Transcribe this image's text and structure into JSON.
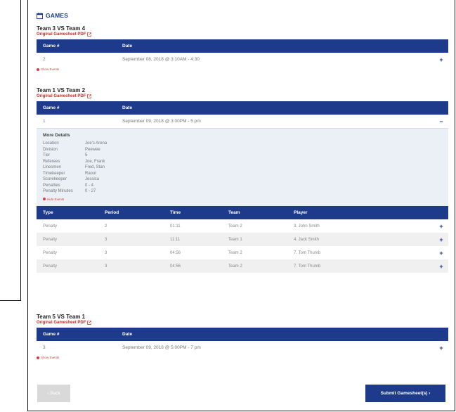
{
  "games_header": {
    "title": "GAMES",
    "icon": "calendar-icon"
  },
  "matches": [
    {
      "title": "Team 3 VS Team 4",
      "pdf_label": "Original Gamesheet PDF",
      "headers": {
        "game": "Game #",
        "date": "Date"
      },
      "row": {
        "game": "2",
        "date": "September 08, 2018 @ 3:10AM - 4:30",
        "action": "+"
      },
      "events_toggle": "Show Events"
    },
    {
      "title": "Team 1 VS Team 2",
      "pdf_label": "Original Gamesheet PDF",
      "headers": {
        "game": "Game #",
        "date": "Date"
      },
      "row": {
        "game": "1",
        "date": "September 09, 2018 @ 3:00PM - 5 pm",
        "action": "−"
      },
      "details": {
        "title": "More Details",
        "items": [
          {
            "key": "Location",
            "value": "Joe's Arena"
          },
          {
            "key": "Division",
            "value": "Peewee"
          },
          {
            "key": "Tier",
            "value": "5"
          },
          {
            "key": "Referees",
            "value": "Joe, Frank"
          },
          {
            "key": "Linesmen",
            "value": "Fred, Stan"
          },
          {
            "key": "Timekeeper",
            "value": "Raoul"
          },
          {
            "key": "Scorekeeper",
            "value": "Jessica"
          },
          {
            "key": "Penalties",
            "value": "0 - 4"
          },
          {
            "key": "Penalty Minutes",
            "value": "0 - 27"
          }
        ]
      },
      "events_toggle": "Hide Events",
      "events": {
        "headers": {
          "type": "Type",
          "period": "Period",
          "time": "Time",
          "team": "Team",
          "player": "Player"
        },
        "rows": [
          {
            "type": "Penalty",
            "period": "2",
            "time": "01:11",
            "team": "Team 2",
            "player": "3. John Smith",
            "action": "+"
          },
          {
            "type": "Penalty",
            "period": "3",
            "time": "11:11",
            "team": "Team 1",
            "player": "4. Jack Smith",
            "action": "+"
          },
          {
            "type": "Penalty",
            "period": "3",
            "time": "04:56",
            "team": "Team 2",
            "player": "7. Tom Thumb",
            "action": "+"
          },
          {
            "type": "Penalty",
            "period": "3",
            "time": "04:56",
            "team": "Team 2",
            "player": "7. Tom Thumb",
            "action": "+"
          }
        ]
      }
    },
    {
      "title": "Team 5 VS Team 1",
      "pdf_label": "Original Gamesheet PDF",
      "headers": {
        "game": "Game #",
        "date": "Date"
      },
      "row": {
        "game": "3",
        "date": "September 09, 2018 @ 5:00PM - 7 pm",
        "action": "+"
      },
      "events_toggle": "Show Events"
    }
  ],
  "buttons": {
    "back": "‹ Back",
    "submit": "Submit Gamesheet(s) ›"
  },
  "colors": {
    "primary": "#1e3a8a",
    "link": "#d22222",
    "details_bg": "#eaf0f5"
  }
}
